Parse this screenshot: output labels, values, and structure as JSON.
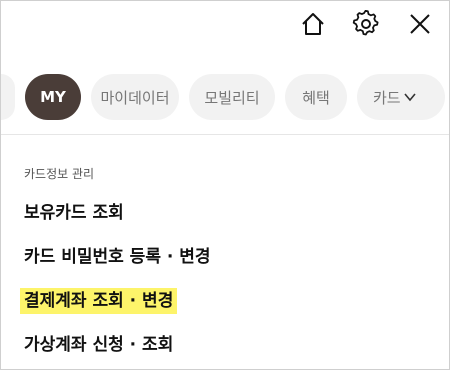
{
  "toolbar": {
    "icons": [
      "home-icon",
      "gear-icon",
      "close-icon"
    ]
  },
  "tabs": [
    {
      "label": "",
      "state": "partial"
    },
    {
      "label": "MY",
      "state": "active"
    },
    {
      "label": "마이데이터",
      "state": "inactive"
    },
    {
      "label": "모빌리티",
      "state": "inactive"
    },
    {
      "label": "혜택",
      "state": "inactive"
    },
    {
      "label": "카드",
      "state": "inactive"
    }
  ],
  "section": {
    "title": "카드정보 관리",
    "items": [
      {
        "label": "보유카드 조회"
      },
      {
        "label": "카드 비밀번호 등록 · 변경"
      },
      {
        "label": "결제계좌 조회 · 변경",
        "highlighted": true
      },
      {
        "label": "가상계좌 신청 · 조회"
      }
    ]
  },
  "colors": {
    "active_tab": "#4a3d38",
    "inactive_tab": "#f2f2f2",
    "highlight": "#fdf46a"
  }
}
